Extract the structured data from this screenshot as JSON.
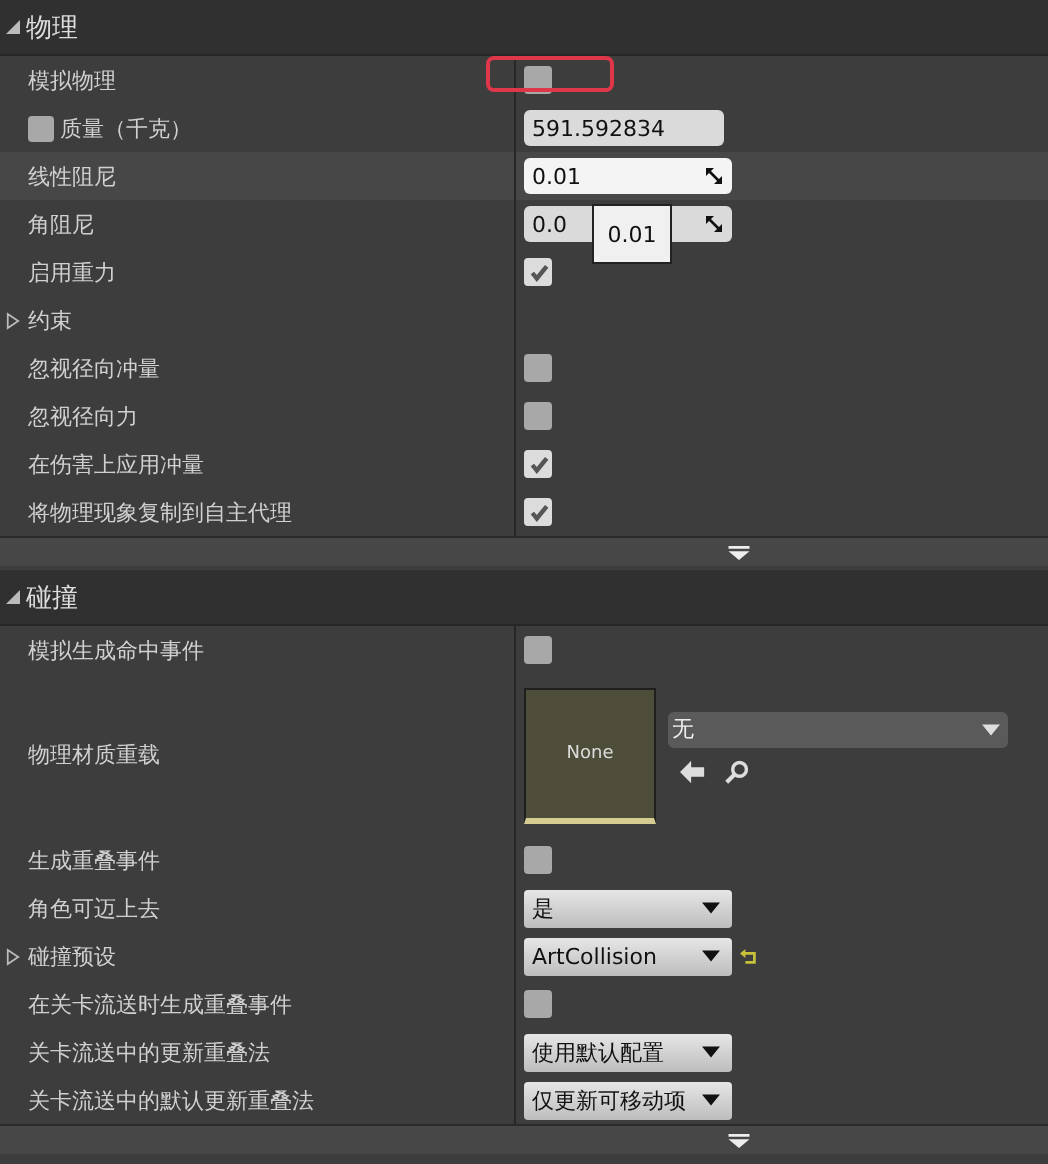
{
  "sections": [
    {
      "title": "物理",
      "expanded": true,
      "has_advanced": true,
      "rows": [
        {
          "kind": "checkbox",
          "label": "模拟物理",
          "checked": false,
          "annotated": true
        },
        {
          "kind": "text",
          "label": "质量（千克）",
          "value": "591.592834",
          "override_checked": false
        },
        {
          "kind": "number",
          "label": "线性阻尼",
          "value": "0.01",
          "focused": true
        },
        {
          "kind": "number",
          "label": "角阻尼",
          "value": "0.0",
          "focused": false,
          "tooltip": "0.01"
        },
        {
          "kind": "checkbox",
          "label": "启用重力",
          "checked": true
        },
        {
          "kind": "group",
          "label": "约束",
          "expanded": false
        },
        {
          "kind": "checkbox",
          "label": "忽视径向冲量",
          "checked": false
        },
        {
          "kind": "checkbox",
          "label": "忽视径向力",
          "checked": false
        },
        {
          "kind": "checkbox",
          "label": "在伤害上应用冲量",
          "checked": true
        },
        {
          "kind": "checkbox",
          "label": "将物理现象复制到自主代理",
          "checked": true
        }
      ]
    },
    {
      "title": "碰撞",
      "expanded": true,
      "has_advanced": true,
      "rows": [
        {
          "kind": "checkbox",
          "label": "模拟生成命中事件",
          "checked": false
        },
        {
          "kind": "asset",
          "label": "物理材质重载",
          "thumbnail_text": "None",
          "value": "无"
        },
        {
          "kind": "checkbox",
          "label": "生成重叠事件",
          "checked": false
        },
        {
          "kind": "dropdown",
          "label": "角色可迈上去",
          "value": "是"
        },
        {
          "kind": "dropdown",
          "label": "碰撞预设",
          "value": "ArtCollision",
          "expanded": false,
          "resettable": true
        },
        {
          "kind": "checkbox",
          "label": "在关卡流送时生成重叠事件",
          "checked": false
        },
        {
          "kind": "dropdown",
          "label": "关卡流送中的更新重叠法",
          "value": "使用默认配置"
        },
        {
          "kind": "dropdown",
          "label": "关卡流送中的默认更新重叠法",
          "value": "仅更新可移动项"
        }
      ]
    }
  ]
}
